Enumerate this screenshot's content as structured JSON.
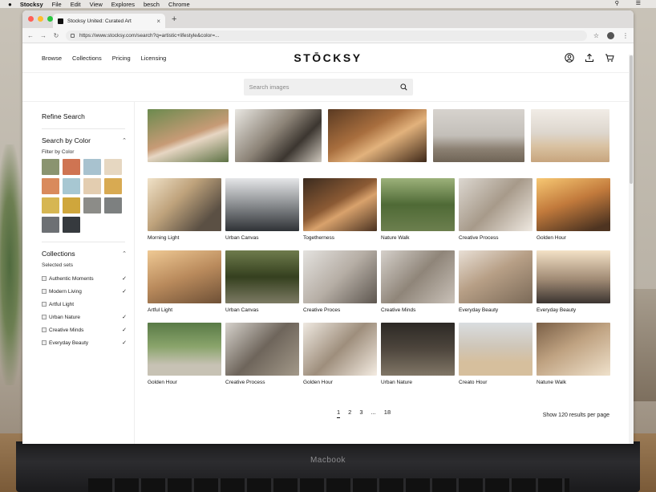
{
  "menubar": {
    "app": "Stocksy",
    "items": [
      "File",
      "Edit",
      "View",
      "Explores",
      "besch",
      "Chrome"
    ]
  },
  "browser": {
    "tab_title": "Stocksy United: Curated Art",
    "url": "https://www.stocksy.com/search?q=artistic+lifestyle&color=..."
  },
  "site": {
    "logo": "STŌCKSY",
    "nav": [
      "Browse",
      "Collections",
      "Pricing",
      "Licensing"
    ],
    "search_placeholder": "Search images"
  },
  "sidebar": {
    "title": "Refine Search",
    "color_section": "Search by Color",
    "color_sub": "Filter by Color",
    "swatches": [
      "#8a9470",
      "#cf7452",
      "#a8c2cf",
      "#e6d7c1",
      "#d98a5c",
      "#a7c7d2",
      "#e3cdb0",
      "#d8aa52",
      "#d6b652",
      "#cfa63c",
      "#8c8c88",
      "#7d8080",
      "#6d7074",
      "#363a3e"
    ],
    "collections_section": "Collections",
    "collections_sub": "Selected sets",
    "collections": [
      {
        "label": "Authentic Moments",
        "checked": true
      },
      {
        "label": "Modern Living",
        "checked": true
      },
      {
        "label": "Artful Light",
        "checked": false
      },
      {
        "label": "Urban Nature",
        "checked": true
      },
      {
        "label": "Creative Minds",
        "checked": true
      },
      {
        "label": "Everyday Beauty",
        "checked": true
      }
    ]
  },
  "grid": {
    "captions": [
      "Morning Light",
      "Urban Canvas",
      "Togetherness",
      "Nature Walk",
      "Creative Process",
      "Golden Hour",
      "Artful Light",
      "Urban Canvas",
      "Creative Proces",
      "Creative Minds",
      "Everyday Beauty",
      "Everyday Beauty",
      "Golden Hour",
      "Creative Process",
      "Golden Hour",
      "Urban Nature",
      "Creato Hour",
      "Natune Walk"
    ]
  },
  "pagination": {
    "pages": [
      "1",
      "2",
      "3",
      "...",
      "18"
    ],
    "per_page": "Show 120 results per page"
  },
  "laptop_label": "Macbook"
}
